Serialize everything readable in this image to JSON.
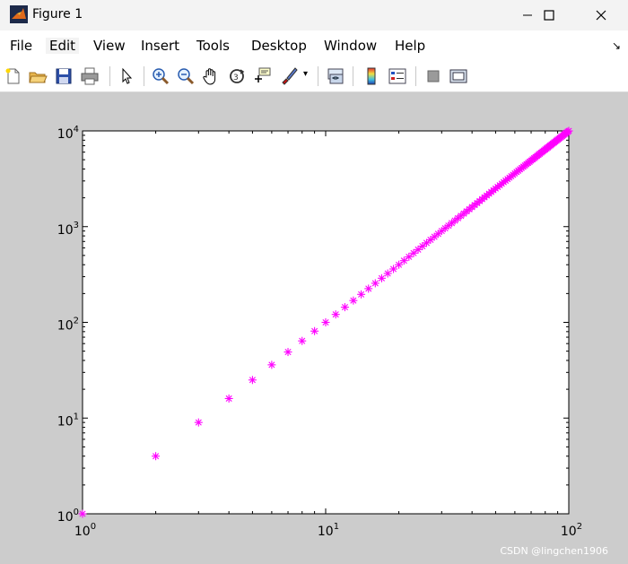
{
  "window": {
    "title": "Figure 1",
    "app_icon": "matlab-icon",
    "controls": [
      "minimize-icon",
      "maximize-icon",
      "close-icon"
    ]
  },
  "menu": {
    "items": [
      "File",
      "Edit",
      "View",
      "Insert",
      "Tools",
      "Desktop",
      "Window",
      "Help"
    ],
    "active": "Edit",
    "dock_icon": "dock-arrow-icon"
  },
  "toolbar": {
    "buttons": [
      "new-figure-icon",
      "open-icon",
      "save-icon",
      "print-icon",
      "pointer-icon",
      "zoom-in-icon",
      "zoom-out-icon",
      "pan-icon",
      "rotate-3d-icon",
      "data-cursor-icon",
      "brush-icon",
      "link-plot-icon",
      "colorbar-icon",
      "legend-icon",
      "hide-plot-tools-icon",
      "show-plot-tools-icon"
    ]
  },
  "watermark": "CSDN @lingchen1906",
  "colors": {
    "marker": "#ff00ff",
    "figure_bg": "#cccccc",
    "axes_bg": "#ffffff"
  },
  "chart_data": {
    "type": "scatter",
    "xscale": "log",
    "yscale": "log",
    "xlim": [
      1,
      100
    ],
    "ylim": [
      1,
      10000
    ],
    "x_tick_labels": [
      {
        "base": "10",
        "exp": "0"
      },
      {
        "base": "10",
        "exp": "1"
      },
      {
        "base": "10",
        "exp": "2"
      }
    ],
    "y_tick_labels": [
      {
        "base": "10",
        "exp": "0"
      },
      {
        "base": "10",
        "exp": "1"
      },
      {
        "base": "10",
        "exp": "2"
      },
      {
        "base": "10",
        "exp": "3"
      },
      {
        "base": "10",
        "exp": "4"
      }
    ],
    "marker": "*",
    "series": [
      {
        "color": "#ff00ff",
        "x": [
          1,
          2,
          3,
          4,
          5,
          6,
          7,
          8,
          9,
          10,
          11,
          12,
          13,
          14,
          15,
          16,
          17,
          18,
          19,
          20,
          21,
          22,
          23,
          24,
          25,
          26,
          27,
          28,
          29,
          30,
          31,
          32,
          33,
          34,
          35,
          36,
          37,
          38,
          39,
          40,
          41,
          42,
          43,
          44,
          45,
          46,
          47,
          48,
          49,
          50,
          51,
          52,
          53,
          54,
          55,
          56,
          57,
          58,
          59,
          60,
          61,
          62,
          63,
          64,
          65,
          66,
          67,
          68,
          69,
          70,
          71,
          72,
          73,
          74,
          75,
          76,
          77,
          78,
          79,
          80,
          81,
          82,
          83,
          84,
          85,
          86,
          87,
          88,
          89,
          90,
          91,
          92,
          93,
          94,
          95,
          96,
          97,
          98,
          99,
          100
        ],
        "y": [
          1,
          4,
          9,
          16,
          25,
          36,
          49,
          64,
          81,
          100,
          121,
          144,
          169,
          196,
          225,
          256,
          289,
          324,
          361,
          400,
          441,
          484,
          529,
          576,
          625,
          676,
          729,
          784,
          841,
          900,
          961,
          1024,
          1089,
          1156,
          1225,
          1296,
          1369,
          1444,
          1521,
          1600,
          1681,
          1764,
          1849,
          1936,
          2025,
          2116,
          2209,
          2304,
          2401,
          2500,
          2601,
          2704,
          2809,
          2916,
          3025,
          3136,
          3249,
          3364,
          3481,
          3600,
          3721,
          3844,
          3969,
          4096,
          4225,
          4356,
          4489,
          4624,
          4761,
          4900,
          5041,
          5184,
          5329,
          5476,
          5625,
          5776,
          5929,
          6084,
          6241,
          6400,
          6561,
          6724,
          6889,
          7056,
          7225,
          7396,
          7569,
          7744,
          7921,
          8100,
          8281,
          8464,
          8649,
          8836,
          9025,
          9216,
          9409,
          9604,
          9801,
          10000
        ]
      }
    ]
  }
}
